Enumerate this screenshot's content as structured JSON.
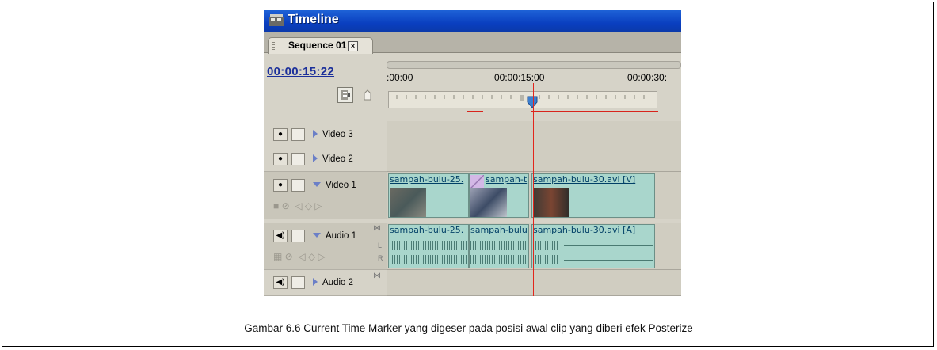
{
  "window": {
    "title": "Timeline"
  },
  "tab": {
    "label": "Sequence 01",
    "close": "×"
  },
  "timecode": "00:00:15:22",
  "ruler": {
    "labels": [
      ":00:00",
      "00:00:15:00",
      "00:00:30:"
    ]
  },
  "tracks": {
    "video3": {
      "name": "Video 3"
    },
    "video2": {
      "name": "Video 2"
    },
    "video1": {
      "name": "Video 1"
    },
    "audio1": {
      "name": "Audio 1"
    },
    "audio2": {
      "name": "Audio 2"
    }
  },
  "clips": {
    "v1a": "sampah-bulu-25.",
    "v1b": "sampah-t",
    "v1c": "sampah-bulu-30.avi [V]",
    "a1a": "sampah-bulu-25.",
    "a1b": "sampah-bulu-",
    "a1c": "sampah-bulu-30.avi [A]"
  },
  "audio_channels": {
    "left": "L",
    "right": "R"
  },
  "caption": "Gambar 6.6 Current Time Marker yang digeser pada posisi awal clip yang diberi efek Posterize",
  "colors": {
    "titlebar": "#0a3fc0",
    "clip": "#a9d6cc",
    "cti": "#e2251c",
    "timecode": "#1b2f9a"
  }
}
